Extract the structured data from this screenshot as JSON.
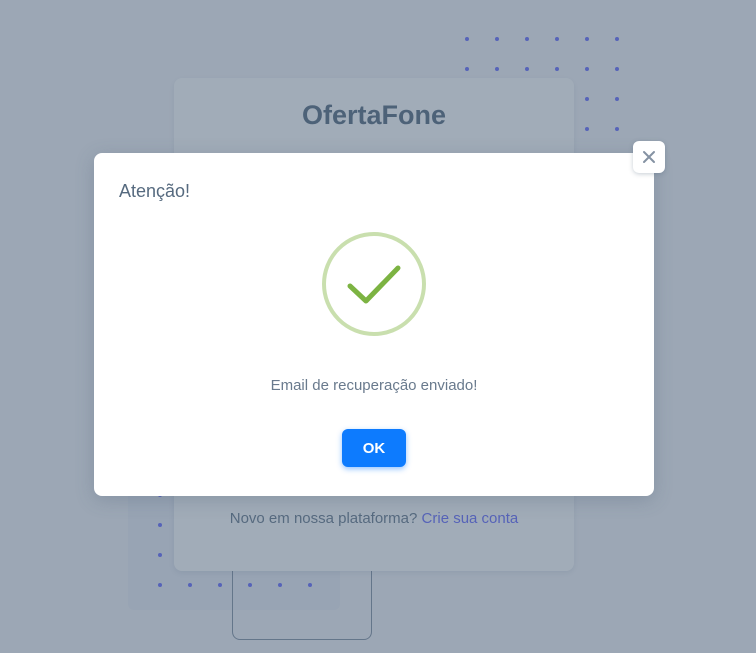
{
  "background": {
    "brand_name": "OfertaFone",
    "signup_prompt": "Novo em nossa plataforma?",
    "signup_link": "Crie sua conta"
  },
  "modal": {
    "title": "Atenção!",
    "message": "Email de recuperação enviado!",
    "ok_label": "OK",
    "icon": "success-check-icon",
    "close_icon": "close-icon"
  },
  "colors": {
    "primary": "#0d7bfe",
    "accent": "#696cff",
    "success_ring": "#c9dfae",
    "success_check": "#7cb342",
    "overlay": "#435971"
  }
}
